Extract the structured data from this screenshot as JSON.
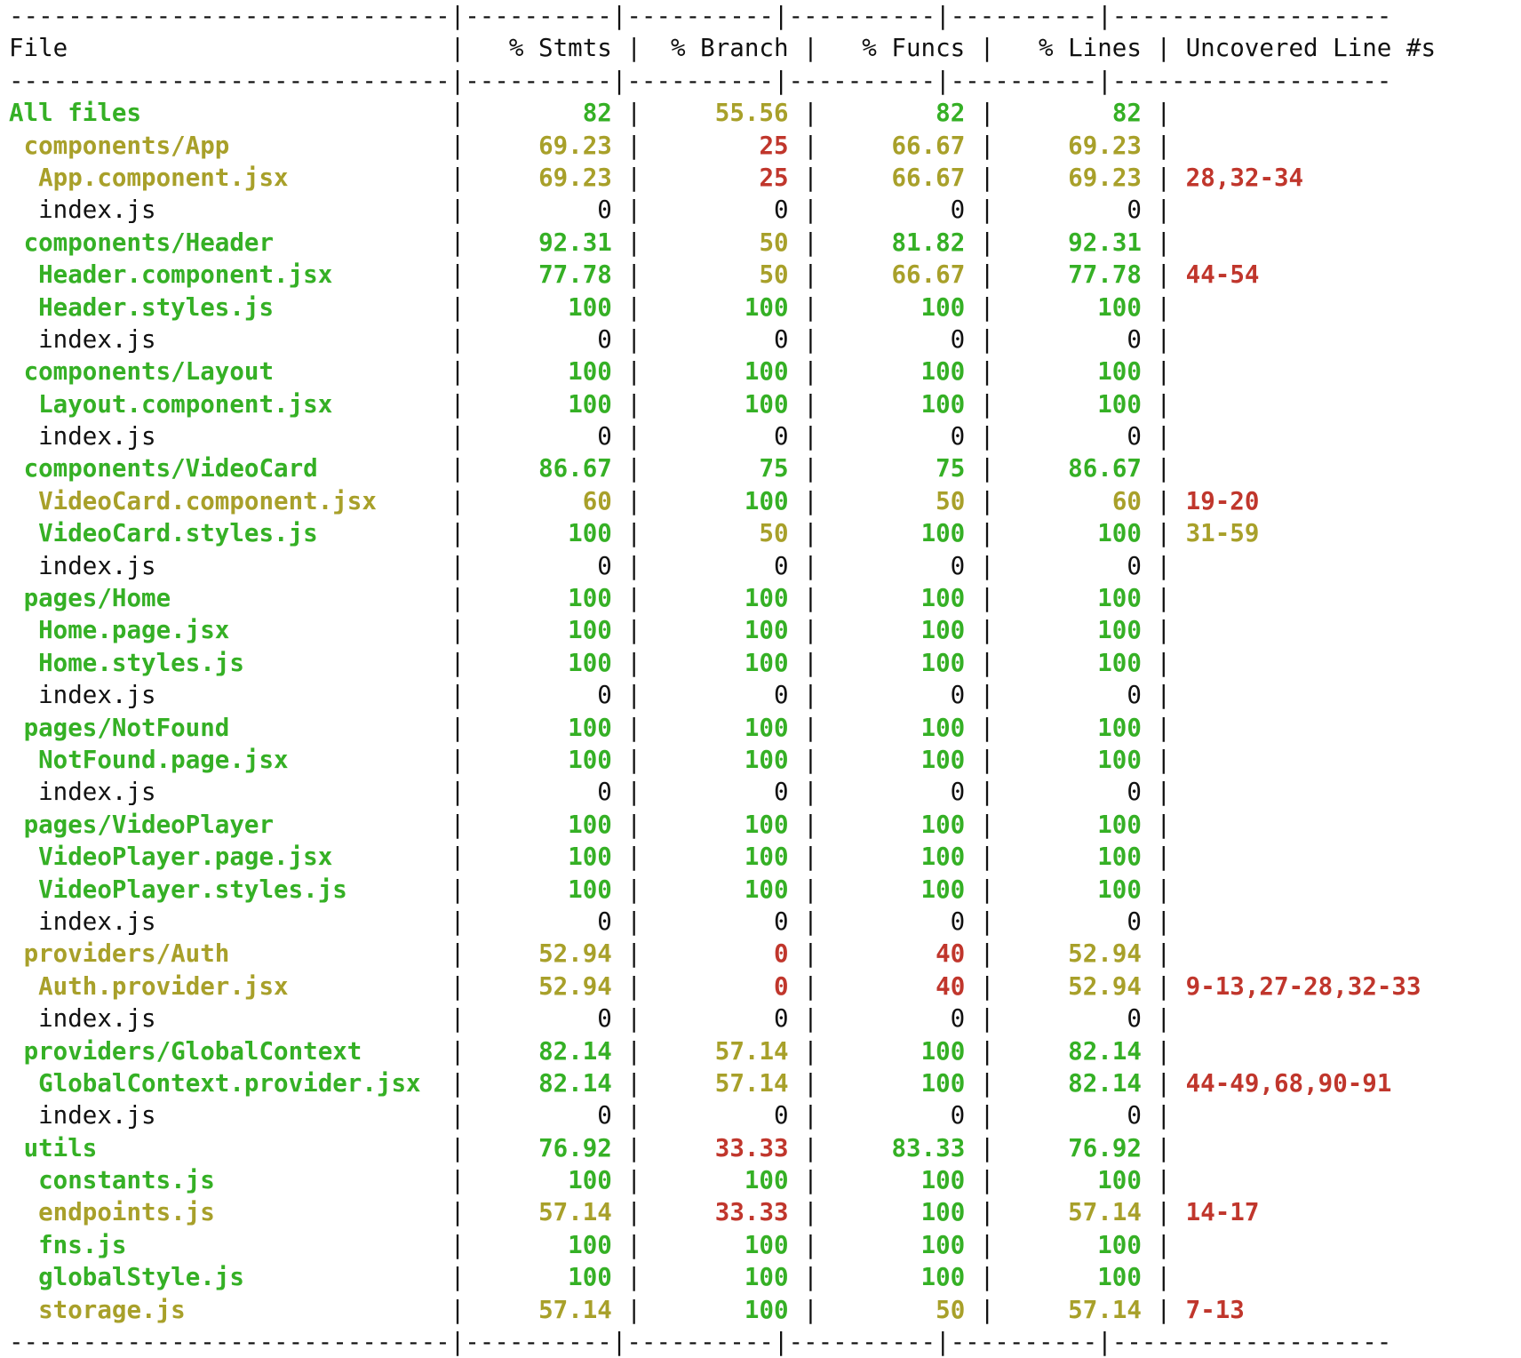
{
  "colors": {
    "green": "#35b025",
    "yellow": "#a8a02a",
    "red": "#c0362c",
    "text": "#111111",
    "background": "#ffffff"
  },
  "coverage_table": {
    "headers": [
      "File",
      "% Stmts",
      "% Branch",
      "% Funcs",
      "% Lines",
      "Uncovered Line #s"
    ],
    "rows": [
      {
        "indent": 0,
        "file": "All files",
        "file_color": "green",
        "stmts": "82",
        "stmts_color": "green",
        "branch": "55.56",
        "branch_color": "yellow",
        "funcs": "82",
        "funcs_color": "green",
        "lines": "82",
        "lines_color": "green",
        "uncovered": "",
        "uncovered_color": "red"
      },
      {
        "indent": 1,
        "file": "components/App",
        "file_color": "yellow",
        "stmts": "69.23",
        "stmts_color": "yellow",
        "branch": "25",
        "branch_color": "red",
        "funcs": "66.67",
        "funcs_color": "yellow",
        "lines": "69.23",
        "lines_color": "yellow",
        "uncovered": "",
        "uncovered_color": "red"
      },
      {
        "indent": 2,
        "file": "App.component.jsx",
        "file_color": "yellow",
        "stmts": "69.23",
        "stmts_color": "yellow",
        "branch": "25",
        "branch_color": "red",
        "funcs": "66.67",
        "funcs_color": "yellow",
        "lines": "69.23",
        "lines_color": "yellow",
        "uncovered": "28,32-34",
        "uncovered_color": "red"
      },
      {
        "indent": 2,
        "file": "index.js",
        "file_color": "plain",
        "stmts": "0",
        "stmts_color": "plain",
        "branch": "0",
        "branch_color": "plain",
        "funcs": "0",
        "funcs_color": "plain",
        "lines": "0",
        "lines_color": "plain",
        "uncovered": "",
        "uncovered_color": "red"
      },
      {
        "indent": 1,
        "file": "components/Header",
        "file_color": "green",
        "stmts": "92.31",
        "stmts_color": "green",
        "branch": "50",
        "branch_color": "yellow",
        "funcs": "81.82",
        "funcs_color": "green",
        "lines": "92.31",
        "lines_color": "green",
        "uncovered": "",
        "uncovered_color": "red"
      },
      {
        "indent": 2,
        "file": "Header.component.jsx",
        "file_color": "green",
        "stmts": "77.78",
        "stmts_color": "green",
        "branch": "50",
        "branch_color": "yellow",
        "funcs": "66.67",
        "funcs_color": "yellow",
        "lines": "77.78",
        "lines_color": "green",
        "uncovered": "44-54",
        "uncovered_color": "red"
      },
      {
        "indent": 2,
        "file": "Header.styles.js",
        "file_color": "green",
        "stmts": "100",
        "stmts_color": "green",
        "branch": "100",
        "branch_color": "green",
        "funcs": "100",
        "funcs_color": "green",
        "lines": "100",
        "lines_color": "green",
        "uncovered": "",
        "uncovered_color": "red"
      },
      {
        "indent": 2,
        "file": "index.js",
        "file_color": "plain",
        "stmts": "0",
        "stmts_color": "plain",
        "branch": "0",
        "branch_color": "plain",
        "funcs": "0",
        "funcs_color": "plain",
        "lines": "0",
        "lines_color": "plain",
        "uncovered": "",
        "uncovered_color": "red"
      },
      {
        "indent": 1,
        "file": "components/Layout",
        "file_color": "green",
        "stmts": "100",
        "stmts_color": "green",
        "branch": "100",
        "branch_color": "green",
        "funcs": "100",
        "funcs_color": "green",
        "lines": "100",
        "lines_color": "green",
        "uncovered": "",
        "uncovered_color": "red"
      },
      {
        "indent": 2,
        "file": "Layout.component.jsx",
        "file_color": "green",
        "stmts": "100",
        "stmts_color": "green",
        "branch": "100",
        "branch_color": "green",
        "funcs": "100",
        "funcs_color": "green",
        "lines": "100",
        "lines_color": "green",
        "uncovered": "",
        "uncovered_color": "red"
      },
      {
        "indent": 2,
        "file": "index.js",
        "file_color": "plain",
        "stmts": "0",
        "stmts_color": "plain",
        "branch": "0",
        "branch_color": "plain",
        "funcs": "0",
        "funcs_color": "plain",
        "lines": "0",
        "lines_color": "plain",
        "uncovered": "",
        "uncovered_color": "red"
      },
      {
        "indent": 1,
        "file": "components/VideoCard",
        "file_color": "green",
        "stmts": "86.67",
        "stmts_color": "green",
        "branch": "75",
        "branch_color": "green",
        "funcs": "75",
        "funcs_color": "green",
        "lines": "86.67",
        "lines_color": "green",
        "uncovered": "",
        "uncovered_color": "red"
      },
      {
        "indent": 2,
        "file": "VideoCard.component.jsx",
        "file_color": "yellow",
        "stmts": "60",
        "stmts_color": "yellow",
        "branch": "100",
        "branch_color": "green",
        "funcs": "50",
        "funcs_color": "yellow",
        "lines": "60",
        "lines_color": "yellow",
        "uncovered": "19-20",
        "uncovered_color": "red"
      },
      {
        "indent": 2,
        "file": "VideoCard.styles.js",
        "file_color": "green",
        "stmts": "100",
        "stmts_color": "green",
        "branch": "50",
        "branch_color": "yellow",
        "funcs": "100",
        "funcs_color": "green",
        "lines": "100",
        "lines_color": "green",
        "uncovered": "31-59",
        "uncovered_color": "yellow"
      },
      {
        "indent": 2,
        "file": "index.js",
        "file_color": "plain",
        "stmts": "0",
        "stmts_color": "plain",
        "branch": "0",
        "branch_color": "plain",
        "funcs": "0",
        "funcs_color": "plain",
        "lines": "0",
        "lines_color": "plain",
        "uncovered": "",
        "uncovered_color": "red"
      },
      {
        "indent": 1,
        "file": "pages/Home",
        "file_color": "green",
        "stmts": "100",
        "stmts_color": "green",
        "branch": "100",
        "branch_color": "green",
        "funcs": "100",
        "funcs_color": "green",
        "lines": "100",
        "lines_color": "green",
        "uncovered": "",
        "uncovered_color": "red"
      },
      {
        "indent": 2,
        "file": "Home.page.jsx",
        "file_color": "green",
        "stmts": "100",
        "stmts_color": "green",
        "branch": "100",
        "branch_color": "green",
        "funcs": "100",
        "funcs_color": "green",
        "lines": "100",
        "lines_color": "green",
        "uncovered": "",
        "uncovered_color": "red"
      },
      {
        "indent": 2,
        "file": "Home.styles.js",
        "file_color": "green",
        "stmts": "100",
        "stmts_color": "green",
        "branch": "100",
        "branch_color": "green",
        "funcs": "100",
        "funcs_color": "green",
        "lines": "100",
        "lines_color": "green",
        "uncovered": "",
        "uncovered_color": "red"
      },
      {
        "indent": 2,
        "file": "index.js",
        "file_color": "plain",
        "stmts": "0",
        "stmts_color": "plain",
        "branch": "0",
        "branch_color": "plain",
        "funcs": "0",
        "funcs_color": "plain",
        "lines": "0",
        "lines_color": "plain",
        "uncovered": "",
        "uncovered_color": "red"
      },
      {
        "indent": 1,
        "file": "pages/NotFound",
        "file_color": "green",
        "stmts": "100",
        "stmts_color": "green",
        "branch": "100",
        "branch_color": "green",
        "funcs": "100",
        "funcs_color": "green",
        "lines": "100",
        "lines_color": "green",
        "uncovered": "",
        "uncovered_color": "red"
      },
      {
        "indent": 2,
        "file": "NotFound.page.jsx",
        "file_color": "green",
        "stmts": "100",
        "stmts_color": "green",
        "branch": "100",
        "branch_color": "green",
        "funcs": "100",
        "funcs_color": "green",
        "lines": "100",
        "lines_color": "green",
        "uncovered": "",
        "uncovered_color": "red"
      },
      {
        "indent": 2,
        "file": "index.js",
        "file_color": "plain",
        "stmts": "0",
        "stmts_color": "plain",
        "branch": "0",
        "branch_color": "plain",
        "funcs": "0",
        "funcs_color": "plain",
        "lines": "0",
        "lines_color": "plain",
        "uncovered": "",
        "uncovered_color": "red"
      },
      {
        "indent": 1,
        "file": "pages/VideoPlayer",
        "file_color": "green",
        "stmts": "100",
        "stmts_color": "green",
        "branch": "100",
        "branch_color": "green",
        "funcs": "100",
        "funcs_color": "green",
        "lines": "100",
        "lines_color": "green",
        "uncovered": "",
        "uncovered_color": "red"
      },
      {
        "indent": 2,
        "file": "VideoPlayer.page.jsx",
        "file_color": "green",
        "stmts": "100",
        "stmts_color": "green",
        "branch": "100",
        "branch_color": "green",
        "funcs": "100",
        "funcs_color": "green",
        "lines": "100",
        "lines_color": "green",
        "uncovered": "",
        "uncovered_color": "red"
      },
      {
        "indent": 2,
        "file": "VideoPlayer.styles.js",
        "file_color": "green",
        "stmts": "100",
        "stmts_color": "green",
        "branch": "100",
        "branch_color": "green",
        "funcs": "100",
        "funcs_color": "green",
        "lines": "100",
        "lines_color": "green",
        "uncovered": "",
        "uncovered_color": "red"
      },
      {
        "indent": 2,
        "file": "index.js",
        "file_color": "plain",
        "stmts": "0",
        "stmts_color": "plain",
        "branch": "0",
        "branch_color": "plain",
        "funcs": "0",
        "funcs_color": "plain",
        "lines": "0",
        "lines_color": "plain",
        "uncovered": "",
        "uncovered_color": "red"
      },
      {
        "indent": 1,
        "file": "providers/Auth",
        "file_color": "yellow",
        "stmts": "52.94",
        "stmts_color": "yellow",
        "branch": "0",
        "branch_color": "red",
        "funcs": "40",
        "funcs_color": "red",
        "lines": "52.94",
        "lines_color": "yellow",
        "uncovered": "",
        "uncovered_color": "red"
      },
      {
        "indent": 2,
        "file": "Auth.provider.jsx",
        "file_color": "yellow",
        "stmts": "52.94",
        "stmts_color": "yellow",
        "branch": "0",
        "branch_color": "red",
        "funcs": "40",
        "funcs_color": "red",
        "lines": "52.94",
        "lines_color": "yellow",
        "uncovered": "9-13,27-28,32-33",
        "uncovered_color": "red"
      },
      {
        "indent": 2,
        "file": "index.js",
        "file_color": "plain",
        "stmts": "0",
        "stmts_color": "plain",
        "branch": "0",
        "branch_color": "plain",
        "funcs": "0",
        "funcs_color": "plain",
        "lines": "0",
        "lines_color": "plain",
        "uncovered": "",
        "uncovered_color": "red"
      },
      {
        "indent": 1,
        "file": "providers/GlobalContext",
        "file_color": "green",
        "stmts": "82.14",
        "stmts_color": "green",
        "branch": "57.14",
        "branch_color": "yellow",
        "funcs": "100",
        "funcs_color": "green",
        "lines": "82.14",
        "lines_color": "green",
        "uncovered": "",
        "uncovered_color": "red"
      },
      {
        "indent": 2,
        "file": "GlobalContext.provider.jsx",
        "file_color": "green",
        "stmts": "82.14",
        "stmts_color": "green",
        "branch": "57.14",
        "branch_color": "yellow",
        "funcs": "100",
        "funcs_color": "green",
        "lines": "82.14",
        "lines_color": "green",
        "uncovered": "44-49,68,90-91",
        "uncovered_color": "red"
      },
      {
        "indent": 2,
        "file": "index.js",
        "file_color": "plain",
        "stmts": "0",
        "stmts_color": "plain",
        "branch": "0",
        "branch_color": "plain",
        "funcs": "0",
        "funcs_color": "plain",
        "lines": "0",
        "lines_color": "plain",
        "uncovered": "",
        "uncovered_color": "red"
      },
      {
        "indent": 1,
        "file": "utils",
        "file_color": "green",
        "stmts": "76.92",
        "stmts_color": "green",
        "branch": "33.33",
        "branch_color": "red",
        "funcs": "83.33",
        "funcs_color": "green",
        "lines": "76.92",
        "lines_color": "green",
        "uncovered": "",
        "uncovered_color": "red"
      },
      {
        "indent": 2,
        "file": "constants.js",
        "file_color": "green",
        "stmts": "100",
        "stmts_color": "green",
        "branch": "100",
        "branch_color": "green",
        "funcs": "100",
        "funcs_color": "green",
        "lines": "100",
        "lines_color": "green",
        "uncovered": "",
        "uncovered_color": "red"
      },
      {
        "indent": 2,
        "file": "endpoints.js",
        "file_color": "yellow",
        "stmts": "57.14",
        "stmts_color": "yellow",
        "branch": "33.33",
        "branch_color": "red",
        "funcs": "100",
        "funcs_color": "green",
        "lines": "57.14",
        "lines_color": "yellow",
        "uncovered": "14-17",
        "uncovered_color": "red"
      },
      {
        "indent": 2,
        "file": "fns.js",
        "file_color": "green",
        "stmts": "100",
        "stmts_color": "green",
        "branch": "100",
        "branch_color": "green",
        "funcs": "100",
        "funcs_color": "green",
        "lines": "100",
        "lines_color": "green",
        "uncovered": "",
        "uncovered_color": "red"
      },
      {
        "indent": 2,
        "file": "globalStyle.js",
        "file_color": "green",
        "stmts": "100",
        "stmts_color": "green",
        "branch": "100",
        "branch_color": "green",
        "funcs": "100",
        "funcs_color": "green",
        "lines": "100",
        "lines_color": "green",
        "uncovered": "",
        "uncovered_color": "red"
      },
      {
        "indent": 2,
        "file": "storage.js",
        "file_color": "yellow",
        "stmts": "57.14",
        "stmts_color": "yellow",
        "branch": "100",
        "branch_color": "green",
        "funcs": "50",
        "funcs_color": "yellow",
        "lines": "57.14",
        "lines_color": "yellow",
        "uncovered": "7-13",
        "uncovered_color": "red"
      }
    ]
  }
}
